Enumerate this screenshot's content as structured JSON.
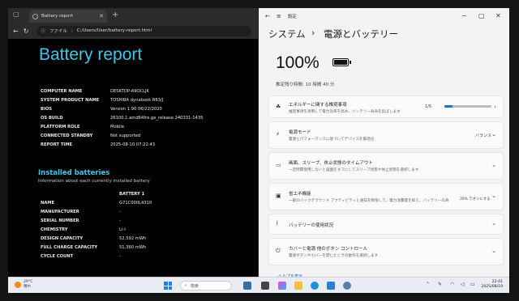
{
  "browser": {
    "tab_title": "Battery report",
    "address_prefix": "ファイル",
    "url": "C:/Users/User/battery-report.html"
  },
  "report": {
    "title": "Battery report",
    "system_info": [
      {
        "key": "COMPUTER NAME",
        "value": "DESKTOP-A9OCLJK"
      },
      {
        "key": "SYSTEM PRODUCT NAME",
        "value": "TOSHIBA dynabook R63/J"
      },
      {
        "key": "BIOS",
        "value": "Version 1.90 06/22/2020"
      },
      {
        "key": "OS BUILD",
        "value": "26100.1.amd64fre.ge_release.240331-1435"
      },
      {
        "key": "PLATFORM ROLE",
        "value": "Mobile"
      },
      {
        "key": "CONNECTED STANDBY",
        "value": "Not supported"
      },
      {
        "key": "REPORT TIME",
        "value": "2025-08-10  07:22:43"
      }
    ],
    "installed_title": "Installed batteries",
    "installed_subtitle": "Information about each currently installed battery",
    "battery_header": "BATTERY 1",
    "battery_rows": [
      {
        "key": "NAME",
        "value": "G71C000L4310"
      },
      {
        "key": "MANUFACTURER",
        "value": "-"
      },
      {
        "key": "SERIAL NUMBER",
        "value": "-"
      },
      {
        "key": "CHEMISTRY",
        "value": "Li-I"
      },
      {
        "key": "DESIGN CAPACITY",
        "value": "52,592 mWh"
      },
      {
        "key": "FULL CHARGE CAPACITY",
        "value": "51,360 mWh"
      },
      {
        "key": "CYCLE COUNT",
        "value": "-"
      }
    ]
  },
  "settings": {
    "window_title": "設定",
    "breadcrumb_parent": "システム",
    "breadcrumb_sep": "›",
    "breadcrumb_current": "電源とバッテリー",
    "battery_percent": "100%",
    "estimate": "推定残り時間: 10 時間 40 分",
    "cards": [
      {
        "title": "エネルギーに関する推奨事項",
        "subtitle": "推奨事項を適用して電力効率を高め、バッテリー寿命を延ばします",
        "value": "1/6",
        "progress": 0.17
      },
      {
        "title": "電源モード",
        "subtitle": "電源とパフォーマンスに基づいてデバイスを最適化",
        "value": "バランス"
      },
      {
        "title": "画面、スリープ、休止状態のタイムアウト",
        "subtitle": "一定時間使用しないと画面をオフにしてスリープ状態や休止状態を選択します"
      },
      {
        "title": "省エネ機能",
        "subtitle": "一部のバックグラウンド アクティビティと通知を制限して、電力消費量を抑え、バッテリーの寿",
        "value": "20% でオンにする"
      },
      {
        "title": "バッテリーの使用状況",
        "subtitle": ""
      },
      {
        "title": "カバーと電源 他のボタン コントロール",
        "subtitle": "電源ボタンやカバーを閉じたときの動作を選択します"
      }
    ],
    "help_link": "ヘルプを表示"
  },
  "taskbar": {
    "temperature": "29°C",
    "weather": "晴れ",
    "search_placeholder": "検索",
    "time": "22:41",
    "date": "2025/08/19"
  }
}
